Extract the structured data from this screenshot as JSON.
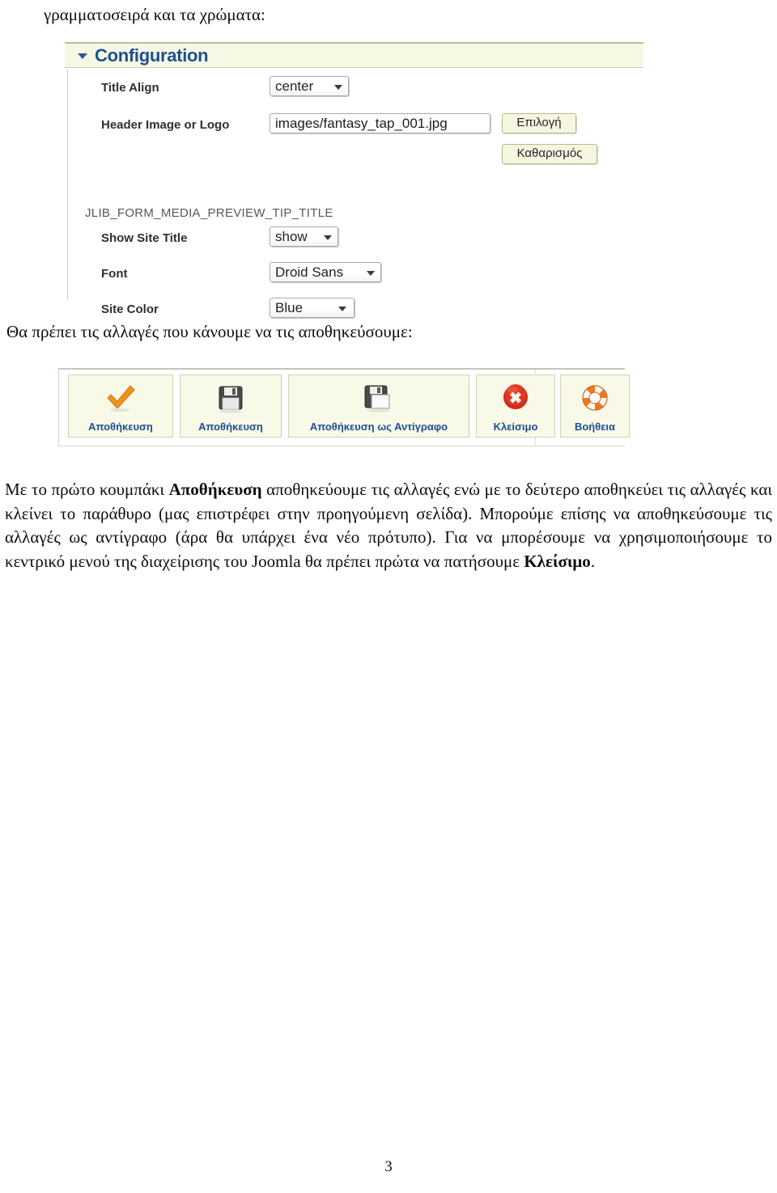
{
  "document": {
    "intro_line": "γραμματοσειρά και τα χρώματα:",
    "middle_line": "Θα πρέπει τις αλλαγές που κάνουμε να τις αποθηκεύσουμε:",
    "page_number": "3",
    "paragraph": {
      "part1": "Με το πρώτο κουμπάκι ",
      "bold1": "Αποθήκευση",
      "part2": " αποθηκεύουμε τις αλλαγές ενώ με το δεύτερο αποθηκεύει τις αλλαγές και κλείνει το παράθυρο (μας επιστρέφει στην προηγούμενη σελίδα). Μπορούμε επίσης να αποθηκεύσουμε τις αλλαγές ως αντίγραφο (άρα θα υπάρχει ένα νέο πρότυπο). Για να μπορέσουμε να χρησιμοποιήσουμε το κεντρικό μενού της διαχείρισης του Joomla θα πρέπει πρώτα να πατήσουμε ",
      "bold2": "Κλείσιμο",
      "part3": "."
    }
  },
  "config_panel": {
    "header_title": "Configuration",
    "header_bg": "#f7f8e3",
    "header_text_color": "#1d4f91",
    "fields": [
      {
        "label": "Title Align",
        "control": "select",
        "value": "center"
      },
      {
        "label": "Header Image or Logo",
        "control": "text",
        "value": "images/fantasy_tap_001.jpg"
      },
      {
        "label": "Show Site Title",
        "control": "select",
        "value": "show"
      },
      {
        "label": "Font",
        "control": "select",
        "value": "Droid Sans"
      },
      {
        "label": "Site Color",
        "control": "select",
        "value": "Blue"
      }
    ],
    "buttons": {
      "select_label": "Επιλογή",
      "clear_label": "Καθαρισμός"
    },
    "preview_tip_key": "JLIB_FORM_MEDIA_PREVIEW_TIP_TITLE"
  },
  "toolbar": {
    "button_bg": "#f9f9e8",
    "label_color": "#1c4f94",
    "buttons": [
      {
        "label": "Αποθήκευση",
        "icon": "orange-checkmark-icon"
      },
      {
        "label": "Αποθήκευση",
        "icon": "floppy-disk-icon"
      },
      {
        "label": "Αποθήκευση ως Αντίγραφο",
        "icon": "floppy-disk-copy-icon"
      },
      {
        "label": "Κλείσιμο",
        "icon": "red-x-circle-icon"
      },
      {
        "label": "Βοήθεια",
        "icon": "lifering-help-icon"
      }
    ]
  }
}
